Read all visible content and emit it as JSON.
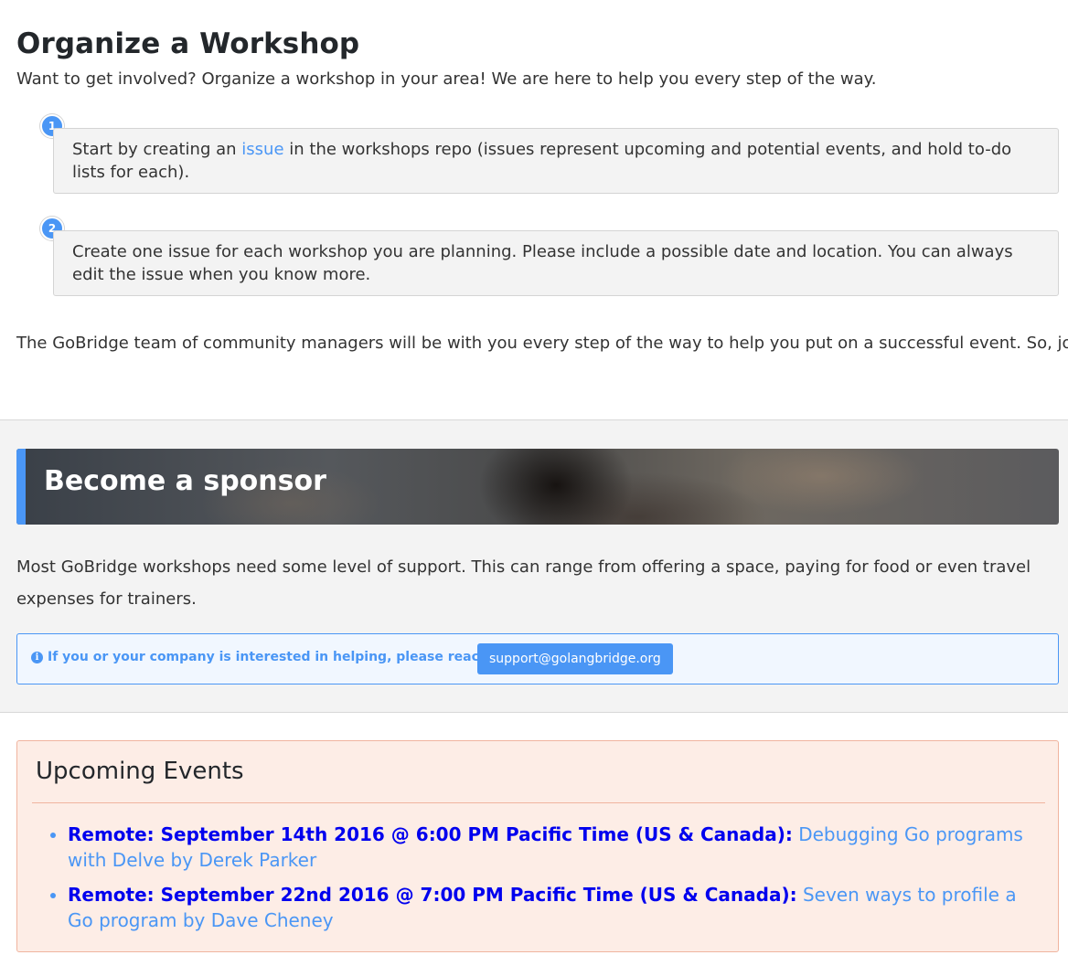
{
  "organize": {
    "title": "Organize a Workshop",
    "intro": "Want to get involved? Organize a workshop in your area! We are here to help you every step of the way.",
    "steps": [
      {
        "number": "1",
        "before_link": "Start by creating an ",
        "link_text": "issue",
        "after_link": " in the workshops repo (issues represent upcoming and potential events, and hold to-do lists for each)."
      },
      {
        "number": "2",
        "text": "Create one issue for each workshop you are planning. Please include a possible date and location. You can always edit the issue when you know more."
      }
    ],
    "outro": "The GoBridge team of community managers will be with you every step of the way to help you put on a successful event. So, join us!"
  },
  "sponsor": {
    "title": "Become a sponsor",
    "description": "Most GoBridge workshops need some level of support. This can range from offering a space, paying for food or even travel expenses for trainers.",
    "callout_icon": "info-icon",
    "callout_text": "If you or your company is interested in helping, please reach out to",
    "email": "support@golangbridge.org"
  },
  "events": {
    "title": "Upcoming Events",
    "items": [
      {
        "when": "Remote: September 14th 2016 @ 6:00 PM Pacific Time (US & Canada):",
        "talk": "Debugging Go programs with Delve by Derek Parker"
      },
      {
        "when": "Remote: September 22nd 2016 @ 7:00 PM Pacific Time (US & Canada):",
        "talk": "Seven ways to profile a Go program by Dave Cheney"
      }
    ]
  },
  "colors": {
    "accent": "#4a96f5",
    "events_bg": "#fdede6",
    "events_border": "#f0b49f",
    "section_bg": "#f3f3f3"
  }
}
